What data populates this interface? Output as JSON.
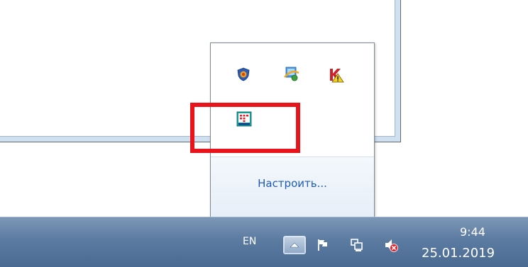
{
  "popup": {
    "customize_label": "Настроить..."
  },
  "tray_icons": [
    {
      "name": "security-shield-icon"
    },
    {
      "name": "internet-network-icon"
    },
    {
      "name": "kaspersky-warning-icon"
    },
    {
      "name": "keypad-app-icon"
    }
  ],
  "taskbar": {
    "language": "EN",
    "time": "9:44",
    "date": "25.01.2019"
  },
  "colors": {
    "highlight": "#e8131b",
    "link": "#1e5bb8",
    "taskbar": "#5c7ba1"
  }
}
